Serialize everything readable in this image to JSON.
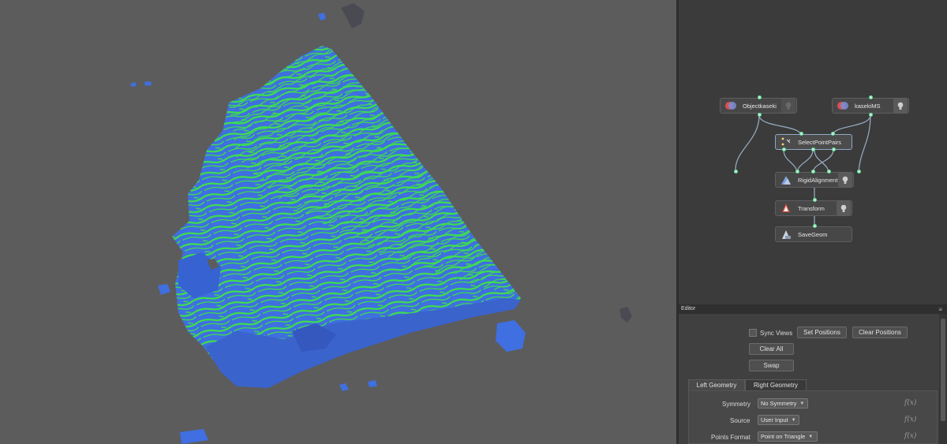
{
  "graph": {
    "nodes": [
      {
        "id": "objectkaseki",
        "label": "Objectkaseki"
      },
      {
        "id": "kasekims",
        "label": "kasekiMS"
      },
      {
        "id": "selectpointpairs",
        "label": "SelectPointPairs"
      },
      {
        "id": "rigidalignment",
        "label": "RigidAlignment"
      },
      {
        "id": "transform",
        "label": "Transform"
      },
      {
        "id": "savegeom",
        "label": "SaveGeom"
      }
    ]
  },
  "editor": {
    "title": "Editor",
    "sync_views": {
      "label": "Sync Views",
      "checked": false
    },
    "buttons": {
      "set_positions": "Set Positions",
      "clear_positions": "Clear Positions",
      "clear_all": "Clear All",
      "swap": "Swap"
    },
    "tabs": [
      {
        "label": "Left Geometry",
        "active": true
      },
      {
        "label": "Right Geometry",
        "active": false
      }
    ],
    "fields": [
      {
        "label": "Symmetry",
        "value": "No Symmetry"
      },
      {
        "label": "Source",
        "value": "User Input"
      },
      {
        "label": "Points Format",
        "value": "Point on Triangle"
      }
    ],
    "fx_glyph": "f(x)"
  },
  "colors": {
    "mesh_blue": "#3f6fe0",
    "mesh_green": "#3ee04a",
    "viewport_bg": "#5c5c5c",
    "graph_bg": "#3b3b3b",
    "wire": "#9aaec4",
    "port": "#b9f0d6"
  },
  "icons": {
    "sync_views_checkbox": "checkbox-icon",
    "bulb": "lightbulb-icon",
    "panel_menu": "hamburger-icon"
  }
}
